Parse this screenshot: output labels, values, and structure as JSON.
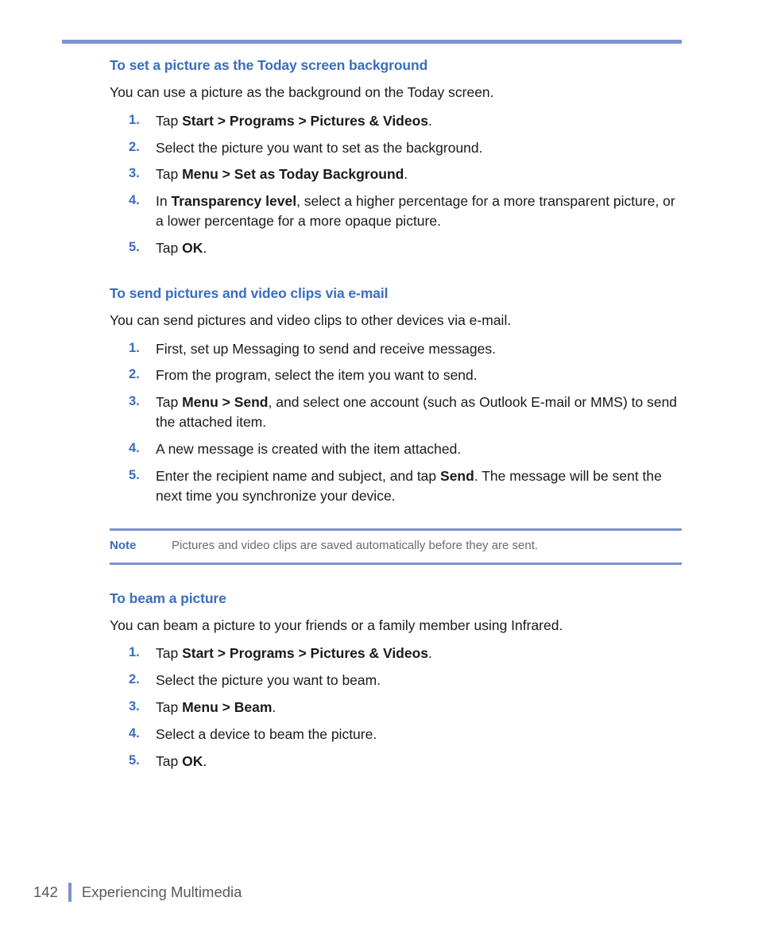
{
  "colors": {
    "heading_blue": "#3a6dc0",
    "rule_blue": "#7b91d0",
    "body_text": "#1a1a1a",
    "note_text": "#6b6b6b",
    "footer_text": "#595959"
  },
  "sections": [
    {
      "heading": "To set a picture as the Today screen background",
      "intro": "You can use a picture as the background on the Today screen.",
      "steps": [
        {
          "num": "1.",
          "parts": [
            {
              "t": "Tap ",
              "b": false
            },
            {
              "t": "Start > Programs > Pictures & Videos",
              "b": true
            },
            {
              "t": ".",
              "b": false
            }
          ]
        },
        {
          "num": "2.",
          "parts": [
            {
              "t": "Select the picture you want to set as the background.",
              "b": false
            }
          ]
        },
        {
          "num": "3.",
          "parts": [
            {
              "t": "Tap ",
              "b": false
            },
            {
              "t": "Menu > Set as Today Background",
              "b": true
            },
            {
              "t": ".",
              "b": false
            }
          ]
        },
        {
          "num": "4.",
          "parts": [
            {
              "t": "In ",
              "b": false
            },
            {
              "t": "Transparency level",
              "b": true
            },
            {
              "t": ", select a higher percentage for a more transparent picture, or a lower percentage for a more opaque picture.",
              "b": false
            }
          ]
        },
        {
          "num": "5.",
          "parts": [
            {
              "t": "Tap ",
              "b": false
            },
            {
              "t": "OK",
              "b": true
            },
            {
              "t": ".",
              "b": false
            }
          ]
        }
      ]
    },
    {
      "heading": "To send pictures and video clips via e-mail",
      "intro": "You can send pictures and video clips to other devices via e-mail.",
      "steps": [
        {
          "num": "1.",
          "parts": [
            {
              "t": "First, set up Messaging to send and receive messages.",
              "b": false
            }
          ]
        },
        {
          "num": "2.",
          "parts": [
            {
              "t": "From the program, select the item you want to send.",
              "b": false
            }
          ]
        },
        {
          "num": "3.",
          "parts": [
            {
              "t": "Tap ",
              "b": false
            },
            {
              "t": "Menu > Send",
              "b": true
            },
            {
              "t": ", and select one account (such as Outlook E-mail or MMS) to send the attached item.",
              "b": false
            }
          ]
        },
        {
          "num": "4.",
          "parts": [
            {
              "t": "A new message is created with the item attached.",
              "b": false
            }
          ]
        },
        {
          "num": "5.",
          "parts": [
            {
              "t": "Enter the recipient name and subject, and tap ",
              "b": false
            },
            {
              "t": "Send",
              "b": true
            },
            {
              "t": ". The message will be sent the next time you synchronize your device.",
              "b": false
            }
          ]
        }
      ]
    },
    {
      "heading": "To beam a picture",
      "intro": "You can beam a picture to your friends or a family member using Infrared.",
      "steps": [
        {
          "num": "1.",
          "parts": [
            {
              "t": "Tap ",
              "b": false
            },
            {
              "t": "Start > Programs > Pictures & Videos",
              "b": true
            },
            {
              "t": ".",
              "b": false
            }
          ]
        },
        {
          "num": "2.",
          "parts": [
            {
              "t": "Select the picture you want to beam.",
              "b": false
            }
          ]
        },
        {
          "num": "3.",
          "parts": [
            {
              "t": "Tap ",
              "b": false
            },
            {
              "t": "Menu > Beam",
              "b": true
            },
            {
              "t": ".",
              "b": false
            }
          ]
        },
        {
          "num": "4.",
          "parts": [
            {
              "t": "Select a device to beam the picture.",
              "b": false
            }
          ]
        },
        {
          "num": "5.",
          "parts": [
            {
              "t": "Tap ",
              "b": false
            },
            {
              "t": "OK",
              "b": true
            },
            {
              "t": ".",
              "b": false
            }
          ]
        }
      ]
    }
  ],
  "note": {
    "label": "Note",
    "text": "Pictures and video clips are saved automatically before they are sent."
  },
  "footer": {
    "page_number": "142",
    "title": "Experiencing Multimedia"
  }
}
